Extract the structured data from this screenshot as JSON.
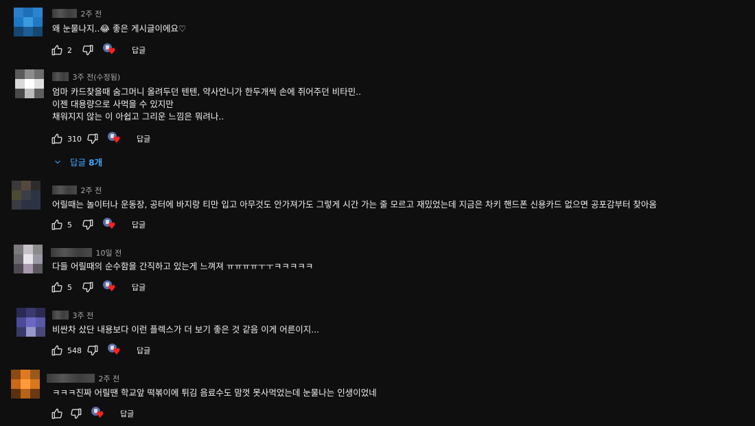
{
  "comments": [
    {
      "time": "2주 전",
      "lines": [
        "왜 눈물나지..😂 좋은 게시글이에요♡"
      ],
      "likes": "2",
      "reply": "답글",
      "avatar_colors": [
        "#2d7fc9",
        "#1f6fbb",
        "#2a85d1",
        "#1e77c4",
        "#3a9ae0",
        "#2278c0",
        "#15466f",
        "#1b5d95",
        "#14486f"
      ]
    },
    {
      "time": "3주 전(수정됨)",
      "lines": [
        "엄마 카드찾을때 숨그머니 올려두던 텐텐, 약사언니가 한두개씩 손에 쥐어주던 비타민..",
        "이젠 대용량으로 사먹을 수 있지만",
        "채워지지 않는 이 아쉽고 그리운 느낌은 뭐려나.."
      ],
      "likes": "310",
      "reply": "답글",
      "avatar_colors": [
        "#5a5a5a",
        "#8c8c8c",
        "#6e6e6e",
        "#d8d8d8",
        "#ffffff",
        "#e0e0e0",
        "#4a4a4a",
        "#bdbdbd",
        "#5e5e5e"
      ],
      "replies_toggle": {
        "prefix": "답글 ",
        "count": "8개"
      }
    },
    {
      "time": "2주 전",
      "lines": [
        "어릴때는 놀이터나 운동장, 공터에 바지랑 티만 입고 아무것도 안가져가도 그렇게 시간 가는 줄 모르고 재밌었는데 지금은 차키 핸드폰 신용카드 없으면 공포감부터 찾아옴"
      ],
      "likes": "5",
      "reply": "답글",
      "avatar_colors": [
        "#3c3a38",
        "#54483e",
        "#2e2c2a",
        "#4d4a36",
        "#3b3e44",
        "#2c3545",
        "#3a3c42",
        "#2d3240",
        "#2b3444"
      ]
    },
    {
      "time": "10일 전",
      "lines": [
        "다들 어릴때의 순수함을 간직하고 있는게 느껴져 ㅠㅠㅠㅠㅜㅜㅋㅋㅋㅋㅋ"
      ],
      "likes": "5",
      "reply": "답글",
      "avatar_colors": [
        "#7a7a7a",
        "#c8c0c8",
        "#8a8a8a",
        "#6a6a70",
        "#e8e4ec",
        "#9a98a0",
        "#4e4a52",
        "#a898b0",
        "#5c5860"
      ]
    },
    {
      "time": "3주 전",
      "lines": [
        "비싼차 샀단 내용보다 이런 플렉스가 더 보기 좋은 것 같음 이게 어른이지..."
      ],
      "likes": "548",
      "reply": "답글",
      "avatar_colors": [
        "#2a2a55",
        "#3a3a70",
        "#2e2a52",
        "#4d4a9a",
        "#6a68c0",
        "#5a58a8",
        "#3a3a6a",
        "#9a98c8",
        "#4a4878"
      ]
    },
    {
      "time": "2주 전",
      "lines": [
        "ㅋㅋㅋ진짜 어릴땐 학교앞 떡볶이에 튀김 음료수도 맘껏 못사먹었는데 눈물나는 인생이었네"
      ],
      "likes": "",
      "reply": "답글",
      "avatar_colors": [
        "#8a4a10",
        "#e07a20",
        "#9a5a1a",
        "#c86818",
        "#ff9a3a",
        "#d8781c",
        "#5a3010",
        "#b8621a",
        "#6a3a12"
      ]
    }
  ],
  "icons": {
    "like": "thumbs-up-icon",
    "dislike": "thumbs-down-icon",
    "creator_heart": "creator-heart-icon",
    "replies_toggle": "chevron-down-icon"
  },
  "colors": {
    "background": "#0f0f0f",
    "text": "#f1f1f1",
    "secondary": "#aaaaaa",
    "link": "#3ea6ff",
    "heart": "#ff2020"
  }
}
